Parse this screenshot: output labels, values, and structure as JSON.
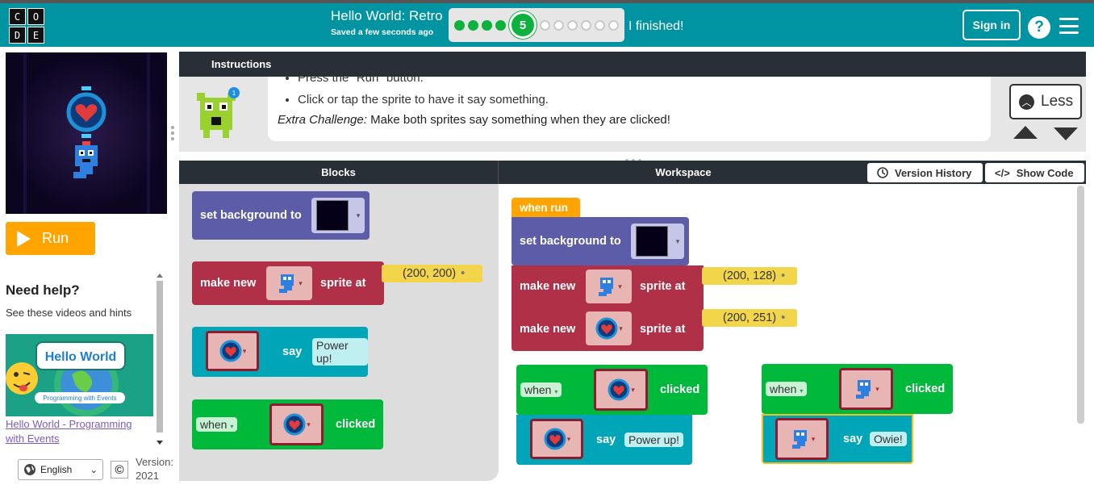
{
  "header": {
    "logo_letters": [
      "C",
      "O",
      "D",
      "E"
    ],
    "title": "Hello World: Retro",
    "saved": "Saved a few seconds ago",
    "progress": {
      "completed": 4,
      "current": 5,
      "remaining": 6,
      "current_label": "5"
    },
    "finished_label": "I finished!",
    "signin_label": "Sign in",
    "help_label": "?"
  },
  "left": {
    "run_label": "Run",
    "need_help": "Need help?",
    "see_videos": "See these videos and hints",
    "thumb_title": "Hello World",
    "thumb_sub": "Programming with Events",
    "thumb_caption": "Hello World - Programming with Events",
    "language": "English",
    "copyright": "©",
    "version_label": "Version:",
    "version_value": "2021"
  },
  "instructions": {
    "tab": "Instructions",
    "line_clipped": "Press the \"Run\" button.",
    "line2": "Click or tap the sprite to have it say something.",
    "extra_label": "Extra Challenge:",
    "extra_text": " Make both sprites say something when they are clicked!",
    "less_label": "Less",
    "badge": "1"
  },
  "panels": {
    "blocks_title": "Blocks",
    "workspace_title": "Workspace",
    "version_history": "Version History",
    "show_code": "Show Code"
  },
  "toolbox": {
    "set_background": "set background to",
    "make_new": "make new",
    "sprite_at": "sprite at",
    "coord": "(200, 200)",
    "say": "say",
    "say_text": "Power up!",
    "when": "when",
    "clicked": "clicked"
  },
  "workspace": {
    "when_run": "when run",
    "set_background": "set background to",
    "make_new": "make new",
    "sprite_at": "sprite at",
    "coord1": "(200, 128)",
    "coord2": "(200, 251)",
    "when": "when",
    "clicked": "clicked",
    "say": "say",
    "say1": "Power up!",
    "say2": "Owie!"
  },
  "colors": {
    "topbar": "#0094a3",
    "run": "#ffa400",
    "purple_block": "#5c5ca8",
    "red_block": "#b03048",
    "teal_block": "#00a6b8",
    "green_block": "#00b83a",
    "coord_block": "#f2d54a"
  }
}
